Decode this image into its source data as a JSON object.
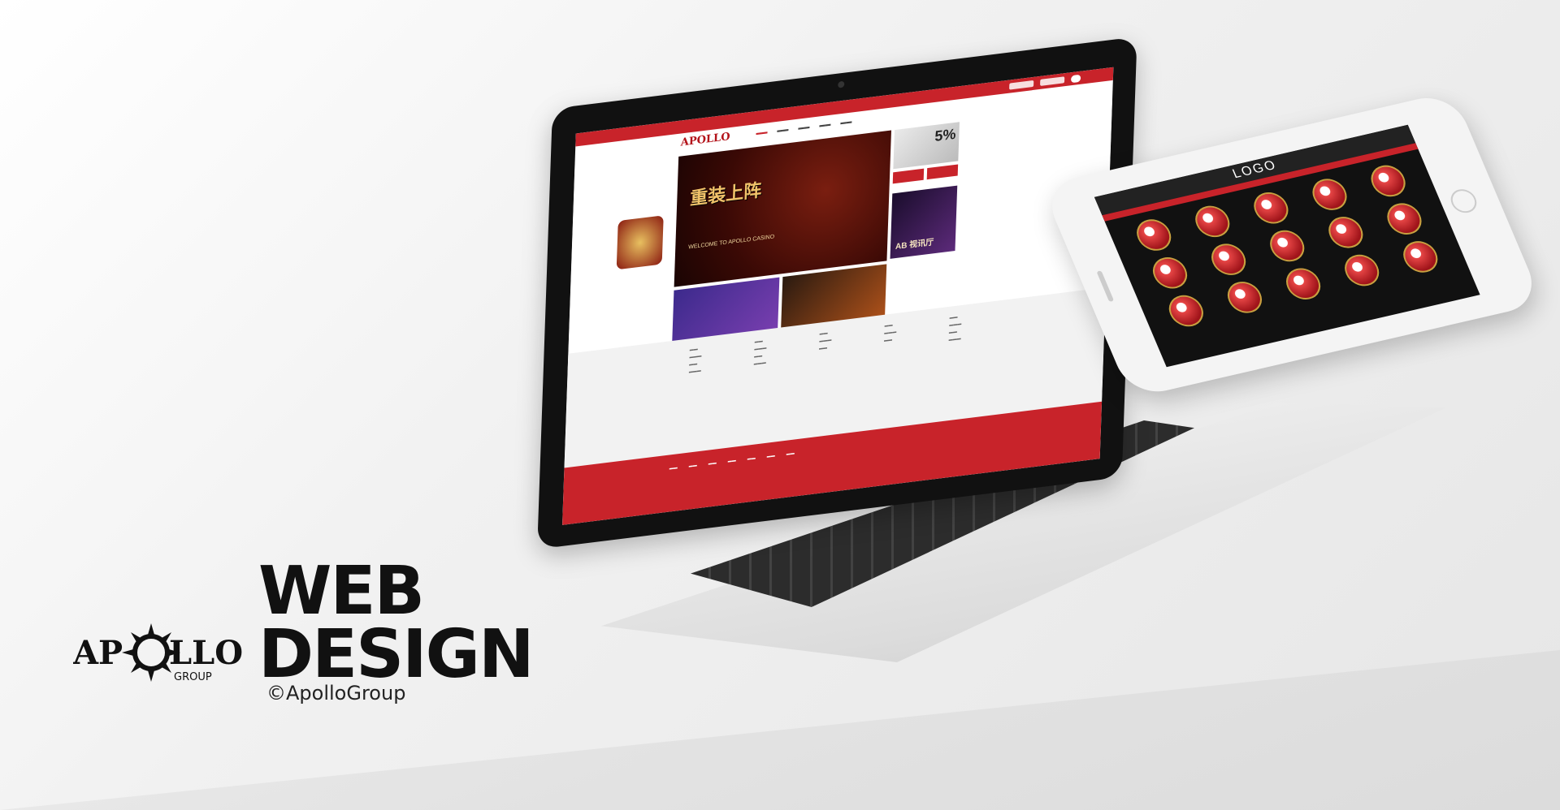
{
  "brand": {
    "heading_line1": "WEB",
    "heading_line2": "DESIGN",
    "copyright": "©ApolloGroup",
    "logo_text": "APOLLO",
    "logo_sub": "GROUP"
  },
  "laptop_site": {
    "logo": "APOLLO",
    "banner_title": "重装上阵",
    "banner_sub": "WELCOME TO APOLLO CASINO",
    "promo_percent": "5%",
    "live_label": "AB 视讯厅"
  },
  "phone_app": {
    "logo": "LOGO"
  },
  "colors": {
    "accent": "#c8232a",
    "text_dark": "#111111"
  }
}
